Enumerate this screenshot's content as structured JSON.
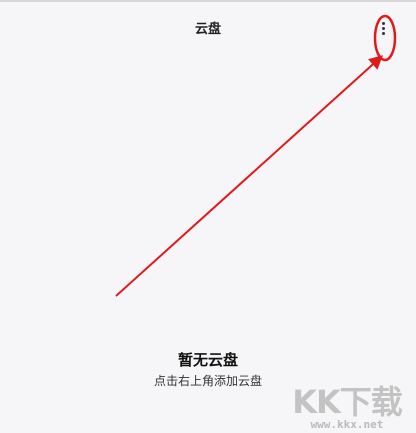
{
  "header": {
    "title": "云盘",
    "more_icon": "more-vertical-icon"
  },
  "empty_state": {
    "title": "暂无云盘",
    "subtitle": "点击右上角添加云盘"
  },
  "annotation": {
    "color": "#e01a1a"
  },
  "watermark": {
    "logo": "KK下载",
    "url": "www.kkx.net"
  }
}
